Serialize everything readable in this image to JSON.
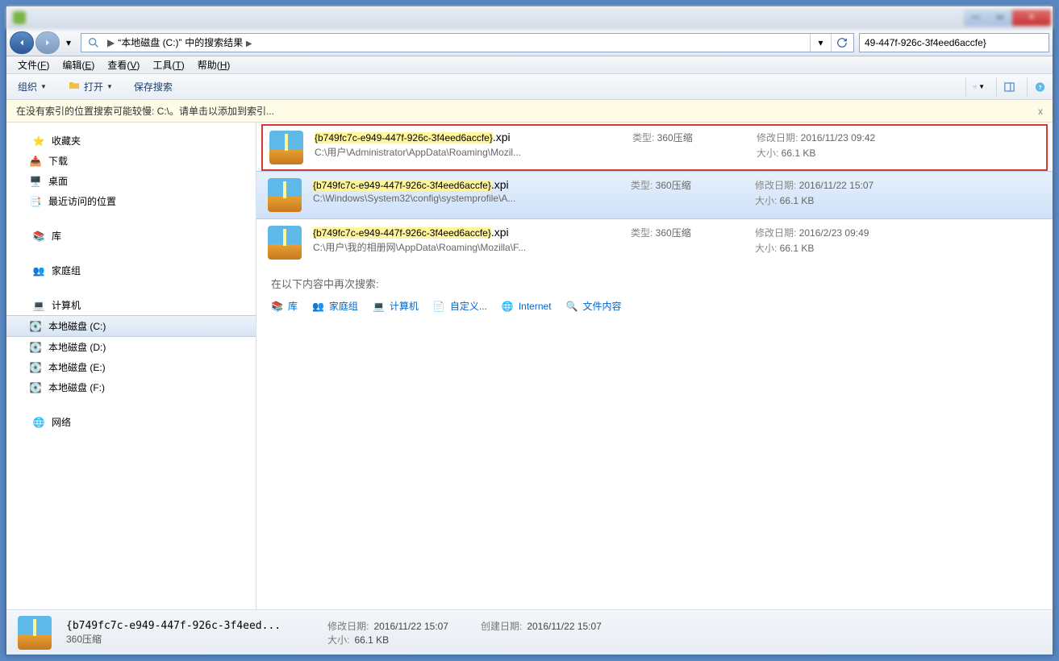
{
  "titlebar": {
    "text": " "
  },
  "window_buttons": {
    "min": "—",
    "max": "▭",
    "close": "✕"
  },
  "nav": {
    "address_prefix": "“本地磁盘 (C:)”",
    "address_suffix": "中的搜索结果",
    "separator": "▶",
    "dropdown_arrow": "▾",
    "refresh_left_arrow": "▾"
  },
  "search": {
    "value": "49-447f-926c-3f4eed6accfe}"
  },
  "menu": {
    "file": "文件(F)",
    "edit": "编辑(E)",
    "view": "查看(V)",
    "tools": "工具(T)",
    "help": "帮助(H)"
  },
  "toolbar": {
    "organize": "组织",
    "open": "打开",
    "save_search": "保存搜索"
  },
  "infobar": {
    "text": "在没有索引的位置搜索可能较慢: C:\\。请单击以添加到索引...",
    "close": "x"
  },
  "sidebar": {
    "favorites": "收藏夹",
    "downloads": "下载",
    "desktop": "桌面",
    "recent": "最近访问的位置",
    "libraries": "库",
    "homegroup": "家庭组",
    "computer": "计算机",
    "drive_c": "本地磁盘 (C:)",
    "drive_d": "本地磁盘 (D:)",
    "drive_e": "本地磁盘 (E:)",
    "drive_f": "本地磁盘 (F:)",
    "network": "网络"
  },
  "results": [
    {
      "name_hl": "{b749fc7c-e949-447f-926c-3f4eed6accfe}",
      "name_ext": ".xpi",
      "path": "C:\\用户\\Administrator\\AppData\\Roaming\\Mozil...",
      "type_label": "类型:",
      "type_value": "360压缩",
      "date_label": "修改日期:",
      "date_value": "2016/11/23 09:42",
      "size_label": "大小:",
      "size_value": "66.1 KB",
      "boxed": true,
      "selected": false
    },
    {
      "name_hl": "{b749fc7c-e949-447f-926c-3f4eed6accfe}",
      "name_ext": ".xpi",
      "path": "C:\\Windows\\System32\\config\\systemprofile\\A...",
      "type_label": "类型:",
      "type_value": "360压缩",
      "date_label": "修改日期:",
      "date_value": "2016/11/22 15:07",
      "size_label": "大小:",
      "size_value": "66.1 KB",
      "boxed": false,
      "selected": true
    },
    {
      "name_hl": "{b749fc7c-e949-447f-926c-3f4eed6accfe}",
      "name_ext": ".xpi",
      "path": "C:\\用户\\我的相册网\\AppData\\Roaming\\Mozilla\\F...",
      "type_label": "类型:",
      "type_value": "360压缩",
      "date_label": "修改日期:",
      "date_value": "2016/2/23 09:49",
      "size_label": "大小:",
      "size_value": "66.1 KB",
      "boxed": false,
      "selected": false
    }
  ],
  "search_again": {
    "label": "在以下内容中再次搜索:",
    "items": [
      "库",
      "家庭组",
      "计算机",
      "自定义...",
      "Internet",
      "文件内容"
    ]
  },
  "status": {
    "filename": "{b749fc7c-e949-447f-926c-3f4eed...",
    "filetype": "360压缩",
    "mod_label": "修改日期:",
    "mod_value": "2016/11/22 15:07",
    "size_label": "大小:",
    "size_value": "66.1 KB",
    "create_label": "创建日期:",
    "create_value": "2016/11/22 15:07"
  }
}
